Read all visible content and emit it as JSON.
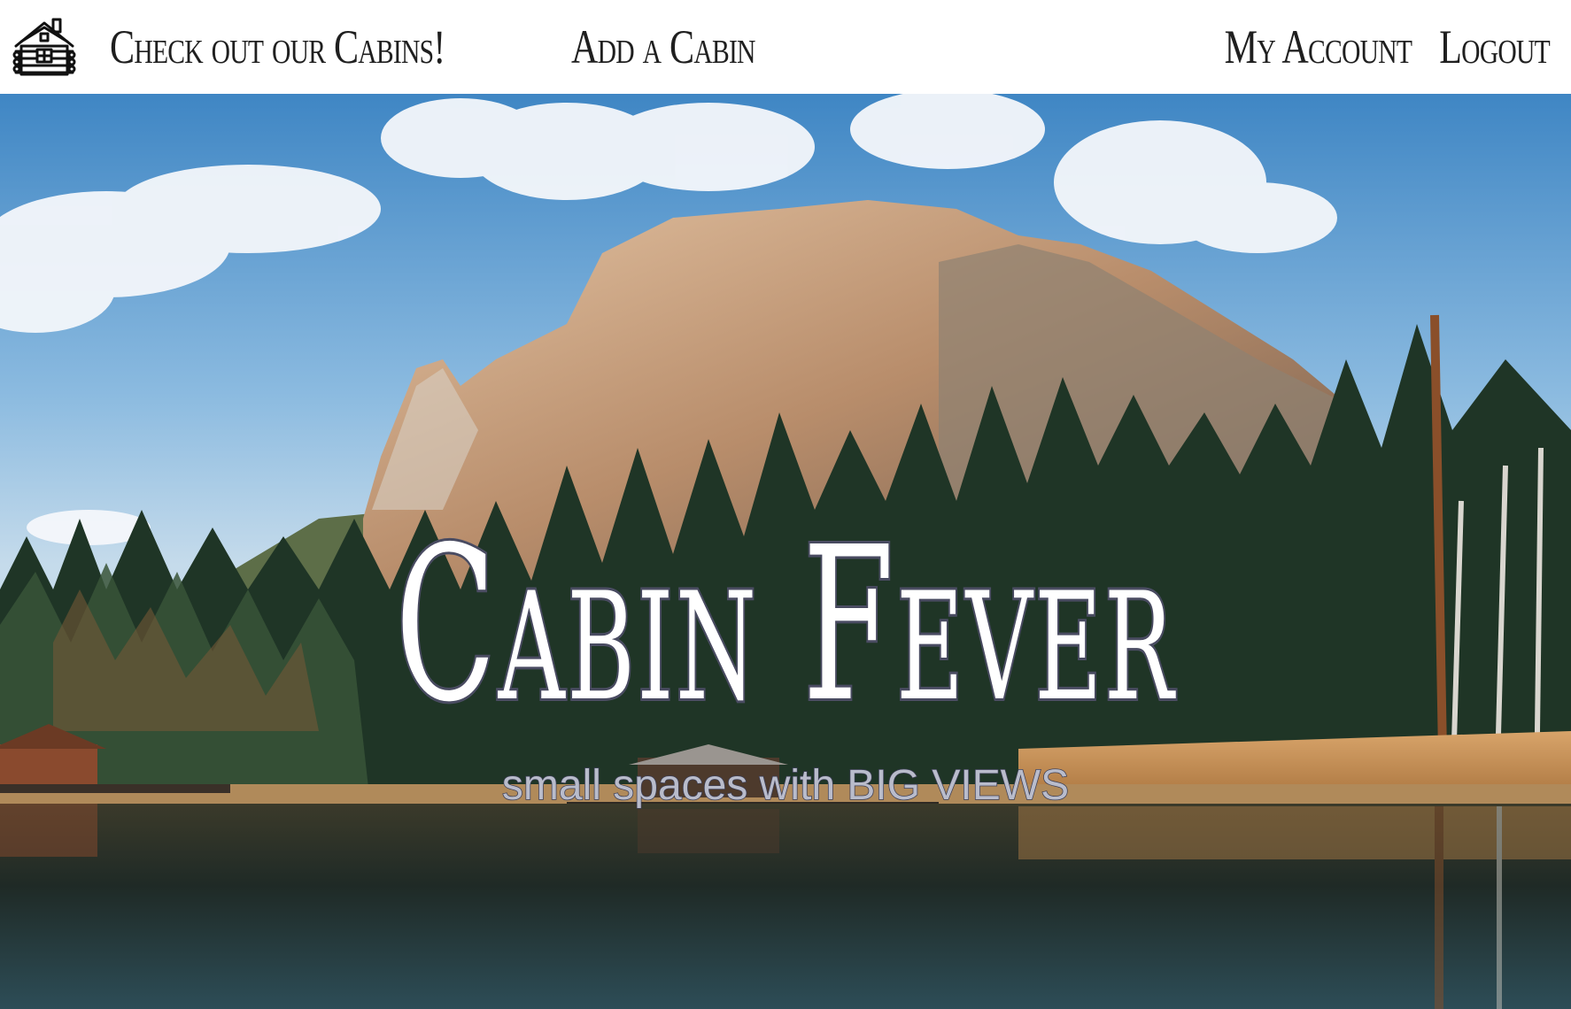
{
  "nav": {
    "logo_icon": "log-cabin-icon",
    "left_links": [
      {
        "label": "Check out our Cabins!"
      },
      {
        "label": "Add a Cabin"
      }
    ],
    "right_links": [
      {
        "label": "My Account"
      },
      {
        "label": "Logout"
      }
    ]
  },
  "hero": {
    "title": "Cabin Fever",
    "subtitle": "small spaces with BIG VIEWS",
    "background": "mountain-lake-forest-photo"
  },
  "colors": {
    "nav_background": "#ffffff",
    "nav_text": "#1f1f1f",
    "title_fill": "#ffffff",
    "title_outline": "#4b4d63",
    "subtitle_fill": "#b9bccb"
  }
}
